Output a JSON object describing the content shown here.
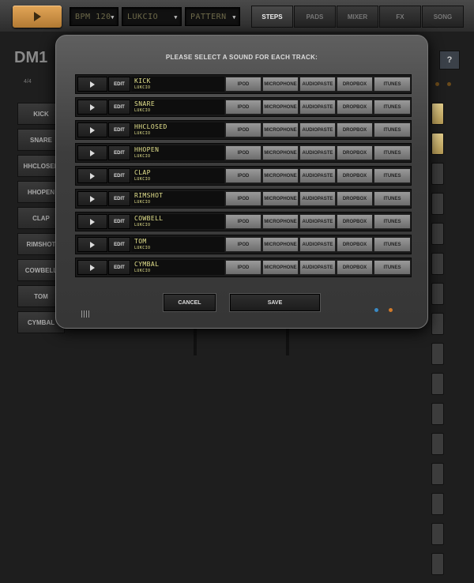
{
  "header": {
    "play_icon": "play-icon",
    "bpm": "BPM 120",
    "kit": "LUKCIO",
    "pattern": "PATTERN",
    "tabs": [
      "STEPS",
      "PADS",
      "MIXER",
      "FX",
      "SONG"
    ],
    "active_tab": "STEPS"
  },
  "app": {
    "logo": "DM1",
    "help": "?",
    "signature": "4/4",
    "side_tracks": [
      "KICK",
      "SNARE",
      "HHCLOSED",
      "HHOPEN",
      "CLAP",
      "RIMSHOT",
      "COWBELL",
      "TOM",
      "CYMBAL"
    ]
  },
  "modal": {
    "title": "PLEASE SELECT A SOUND FOR EACH TRACK:",
    "edit_label": "EDIT",
    "sources": [
      "IPOD",
      "MICROPHONE",
      "AUDIOPASTE",
      "DROPBOX",
      "ITUNES"
    ],
    "tracks": [
      {
        "name": "KICK",
        "kit": "LUKCIO"
      },
      {
        "name": "SNARE",
        "kit": "LUKCIO"
      },
      {
        "name": "HHCLOSED",
        "kit": "LUKCIO"
      },
      {
        "name": "HHOPEN",
        "kit": "LUKCIO"
      },
      {
        "name": "CLAP",
        "kit": "LUKCIO"
      },
      {
        "name": "RIMSHOT",
        "kit": "LUKCIO"
      },
      {
        "name": "COWBELL",
        "kit": "LUKCIO"
      },
      {
        "name": "TOM",
        "kit": "LUKCIO"
      },
      {
        "name": "CYMBAL",
        "kit": "LUKCIO"
      }
    ],
    "cancel_label": "CANCEL",
    "save_label": "SAVE"
  },
  "colors": {
    "accent": "#d79b50",
    "lcd_text": "#e2e08c",
    "led_blue": "#3a8ac4",
    "led_orange": "#d07a2a"
  }
}
